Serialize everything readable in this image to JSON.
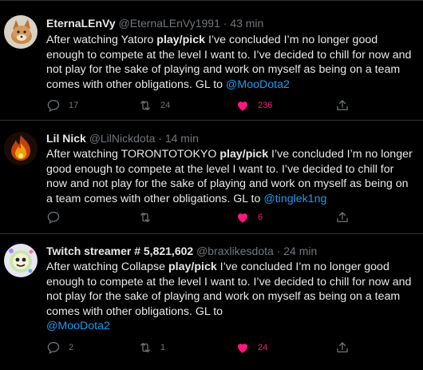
{
  "colors": {
    "background": "#000000",
    "text": "#e7e9ea",
    "muted": "#71767b",
    "link": "#1d9bf0",
    "like": "#f91880",
    "divider": "#2f3336"
  },
  "tweets": [
    {
      "display_name": "EternaLEnVy",
      "handle": "@EternaLEnVy1991",
      "separator": "·",
      "time": "43 min",
      "text_before": "After watching Yatoro ",
      "text_bold": "play/pick",
      "text_after": " I’ve concluded I’m no longer good enough to compete at the level I want to. I’ve decided to chill for now and not play for the sake of playing and work on myself as being on a team comes with other obligations. GL to ",
      "mention": "@MooDota2",
      "replies": "17",
      "retweets": "24",
      "likes": "236",
      "liked": true,
      "avatar_icon": "fox-avatar"
    },
    {
      "display_name": "Lil Nick",
      "handle": "@LilNickdota",
      "separator": "·",
      "time": "14 min",
      "text_before": "After watching TORONTOTOKYO ",
      "text_bold": "play/pick",
      "text_after": " I’ve concluded I’m no longer good enough to compete at the level I want to. I’ve decided to chill for now and not play for the sake of playing and work on myself as being on a team comes with other obligations. GL to ",
      "mention": "@tinglek1ng",
      "replies": "",
      "retweets": "",
      "likes": "6",
      "liked": true,
      "avatar_icon": "fire-avatar"
    },
    {
      "display_name": "Twitch streamer # 5,821,602",
      "handle": "@braxlikesdota",
      "separator": "·",
      "time": "24 min",
      "text_before": "After watching Collapse ",
      "text_bold": "play/pick",
      "text_after": " I’ve concluded I’m no longer good enough to compete at the level I want to. I’ve decided to chill for now and not play for the sake of playing and work on myself as being on a team comes with other obligations. GL to ",
      "mention": "@MooDota2",
      "replies": "2",
      "retweets": "1",
      "likes": "24",
      "liked": true,
      "avatar_icon": "cartoon-avatar"
    }
  ]
}
